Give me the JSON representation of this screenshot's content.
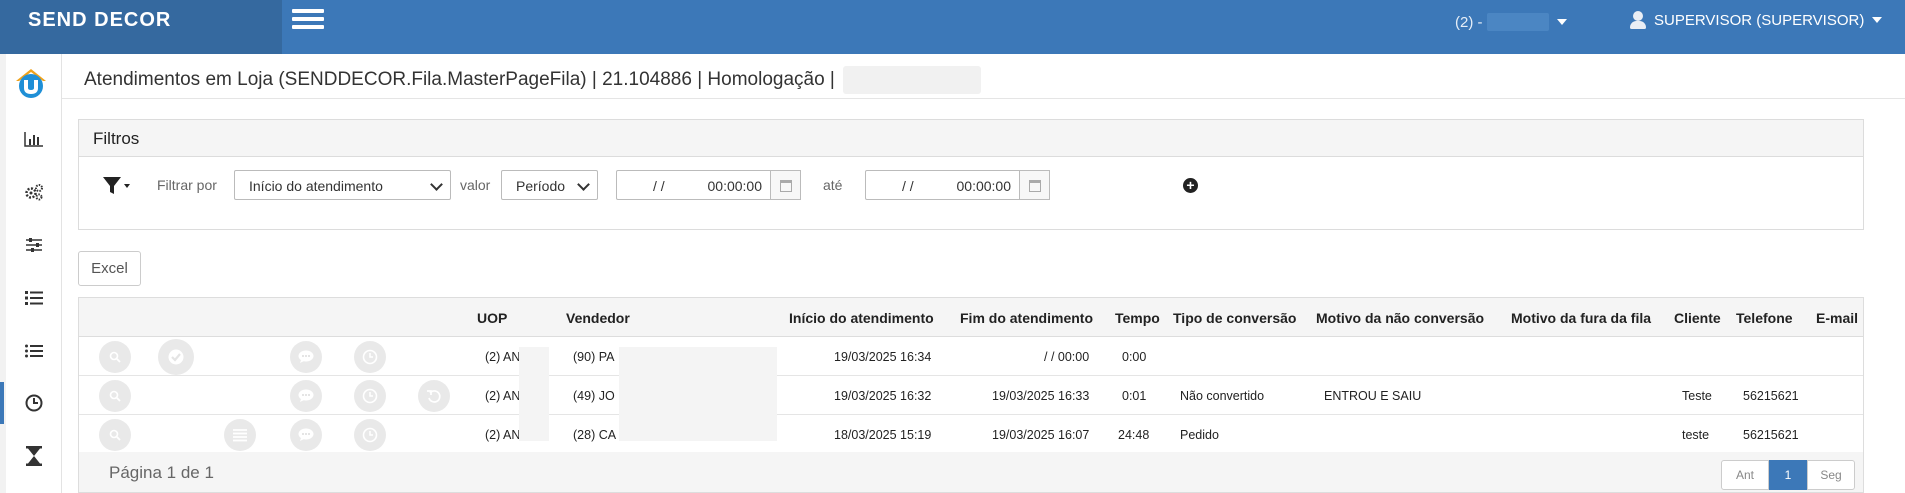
{
  "app": {
    "brand": "SEND DECOR"
  },
  "header": {
    "branch_prefix": "(2) -",
    "user_label": "SUPERVISOR (SUPERVISOR)"
  },
  "sidebar": {
    "items": [
      {
        "name": "home-logo"
      },
      {
        "name": "chart-icon"
      },
      {
        "name": "gears-icon"
      },
      {
        "name": "sliders-icon"
      },
      {
        "name": "ordered-list-icon"
      },
      {
        "name": "list-icon"
      },
      {
        "name": "clock-icon",
        "active": true
      },
      {
        "name": "hourglass-icon"
      }
    ]
  },
  "page": {
    "title": "Atendimentos em Loja (SENDDECOR.Fila.MasterPageFila) | 21.104886 | Homologação |"
  },
  "filters": {
    "panel_title": "Filtros",
    "filter_by_label": "Filtrar por",
    "field_value": "Início do atendimento",
    "value_label": "valor",
    "mode_value": "Período",
    "from_date": "/ /",
    "from_time": "00:00:00",
    "until_label": "até",
    "to_date": "/ /",
    "to_time": "00:00:00"
  },
  "toolbar": {
    "excel_label": "Excel"
  },
  "table": {
    "columns": [
      "UOP",
      "Vendedor",
      "Início do atendimento",
      "Fim do atendimento",
      "Tempo",
      "Tipo de conversão",
      "Motivo da não conversão",
      "Motivo da fura da fila",
      "Cliente",
      "Telefone",
      "E-mail"
    ],
    "rows": [
      {
        "uop": "(2) AN",
        "vendedor": "(90) PA",
        "inicio": "19/03/2025 16:34",
        "fim": "/ / 00:00",
        "tempo": "0:00",
        "tipo": "",
        "motivo_nao": "",
        "motivo_fura": "",
        "cliente": "",
        "telefone": "",
        "email": ""
      },
      {
        "uop": "(2) AN",
        "vendedor": "(49) JO",
        "inicio": "19/03/2025 16:32",
        "fim": "19/03/2025 16:33",
        "tempo": "0:01",
        "tipo": "Não convertido",
        "motivo_nao": "ENTROU E SAIU",
        "motivo_fura": "",
        "cliente": "Teste",
        "telefone": "56215621",
        "email": ""
      },
      {
        "uop": "(2) AN",
        "vendedor": "(28) CA",
        "inicio": "18/03/2025 15:19",
        "fim": "19/03/2025 16:07",
        "tempo": "24:48",
        "tipo": "Pedido",
        "motivo_nao": "",
        "motivo_fura": "",
        "cliente": "teste",
        "telefone": "56215621",
        "email": ""
      }
    ],
    "page_info": "Página 1 de 1",
    "pager": {
      "prev": "Ant",
      "current": "1",
      "next": "Seg"
    }
  }
}
